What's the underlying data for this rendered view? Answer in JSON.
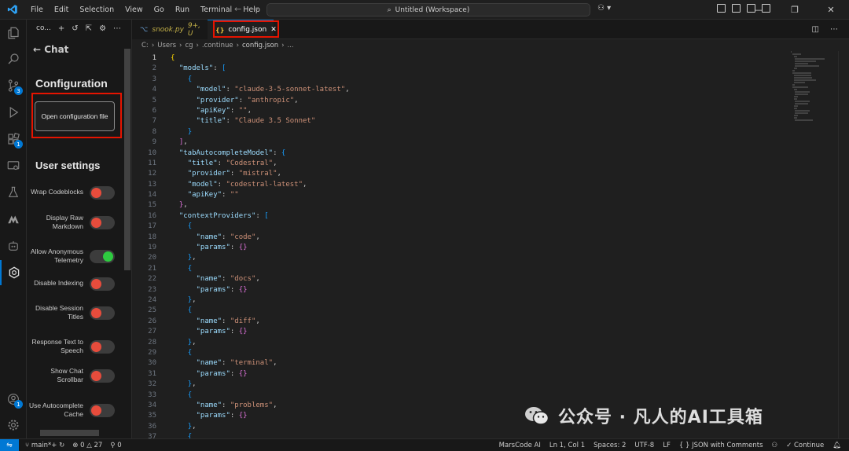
{
  "menu": [
    "File",
    "Edit",
    "Selection",
    "View",
    "Go",
    "Run",
    "Terminal",
    "Help"
  ],
  "search": {
    "label": "Untitled (Workspace)"
  },
  "activity": {
    "source_control_badge": "3",
    "extensions_badge": "1",
    "accounts_badge": "1"
  },
  "sidepanel": {
    "header_label": "co...",
    "back_label": "← Chat",
    "config_title": "Configuration",
    "open_config_button": "Open configuration file",
    "user_settings_title": "User settings",
    "settings": [
      {
        "label": "Wrap Codeblocks",
        "on": false
      },
      {
        "label": "Display Raw Markdown",
        "on": false
      },
      {
        "label": "Allow Anonymous Telemetry",
        "on": true
      },
      {
        "label": "Disable Indexing",
        "on": false
      },
      {
        "label": "Disable Session Titles",
        "on": false
      },
      {
        "label": "Response Text to Speech",
        "on": false
      },
      {
        "label": "Show Chat Scrollbar",
        "on": false
      },
      {
        "label": "Use Autocomplete Cache",
        "on": false
      }
    ]
  },
  "tabs": [
    {
      "name": "snook.py",
      "modified": "9+, U"
    },
    {
      "name": "config.json",
      "icon": "{}"
    }
  ],
  "breadcrumb": [
    "C:",
    "Users",
    "cg",
    ".continue",
    "config.json",
    "..."
  ],
  "code": [
    "{",
    "  \"models\": [",
    "    {",
    "      \"model\": \"claude-3-5-sonnet-latest\",",
    "      \"provider\": \"anthropic\",",
    "      \"apiKey\": \"\",",
    "      \"title\": \"Claude 3.5 Sonnet\"",
    "    }",
    "  ],",
    "  \"tabAutocompleteModel\": {",
    "    \"title\": \"Codestral\",",
    "    \"provider\": \"mistral\",",
    "    \"model\": \"codestral-latest\",",
    "    \"apiKey\": \"\"",
    "  },",
    "  \"contextProviders\": [",
    "    {",
    "      \"name\": \"code\",",
    "      \"params\": {}",
    "    },",
    "    {",
    "      \"name\": \"docs\",",
    "      \"params\": {}",
    "    },",
    "    {",
    "      \"name\": \"diff\",",
    "      \"params\": {}",
    "    },",
    "    {",
    "      \"name\": \"terminal\",",
    "      \"params\": {}",
    "    },",
    "    {",
    "      \"name\": \"problems\",",
    "      \"params\": {}",
    "    },",
    "    {"
  ],
  "watermark": "公众号 · 凡人的AI工具箱",
  "status": {
    "branch": "main*+",
    "errors": "0",
    "warnings": "27",
    "ports": "0",
    "marscode": "MarsCode AI",
    "position": "Ln 1, Col 1",
    "spaces": "Spaces: 2",
    "encoding": "UTF-8",
    "eol": "LF",
    "language": "JSON with Comments",
    "continue": "✓ Continue"
  },
  "colors": {
    "accent": "#0078d4",
    "highlight": "#e51400",
    "toggle_off": "#e74c3c",
    "toggle_on": "#2ecc40"
  }
}
